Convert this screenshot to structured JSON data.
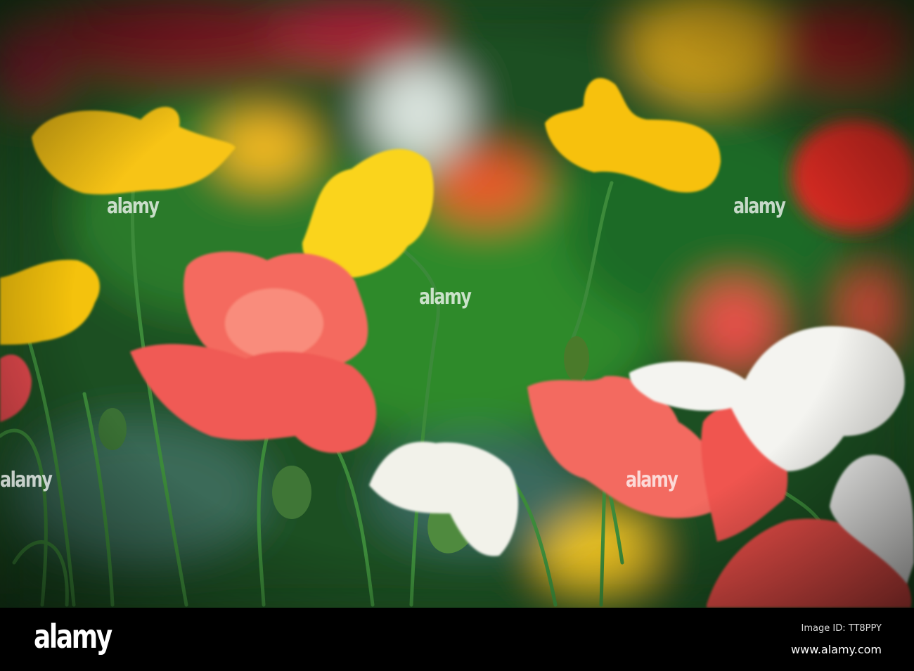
{
  "watermark": {
    "text": "alamy"
  },
  "footer": {
    "logo": "alamy",
    "image_id": "Image ID: TT8PPY",
    "site": "www.alamy.com"
  },
  "colors": {
    "yellow": "#f7c814",
    "coral": "#f2605a",
    "white": "#f4f4f0",
    "stem": "#3c8a3a",
    "background": "#1f5a26"
  }
}
